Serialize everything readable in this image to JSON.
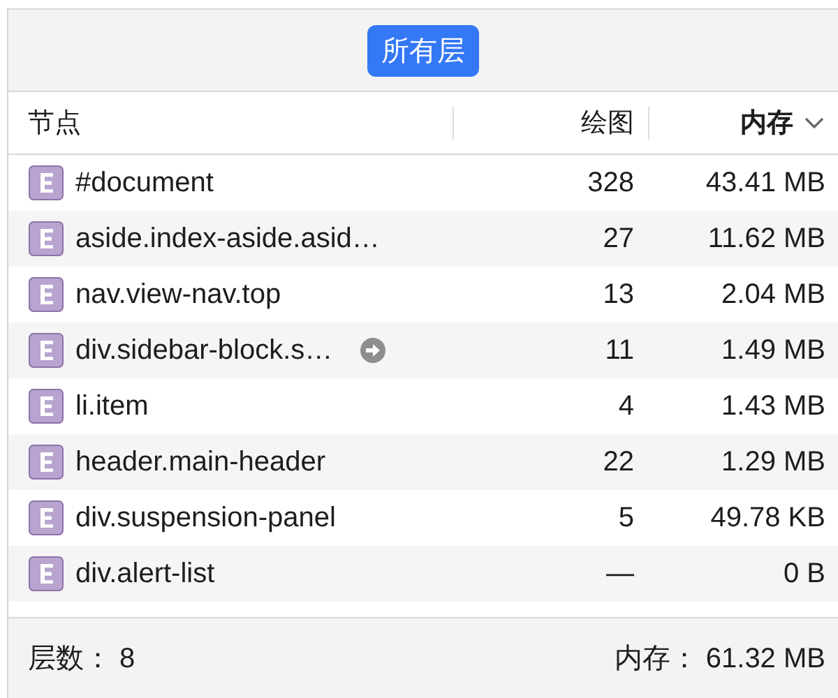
{
  "layer_filter": {
    "label": "所有层",
    "selected": true
  },
  "table": {
    "columns": [
      {
        "label": "节点",
        "sorted": false
      },
      {
        "label": "绘图",
        "sorted": false
      },
      {
        "label": "内存",
        "sorted": true
      }
    ],
    "rows": [
      {
        "node": "#document",
        "paints": "328",
        "memory": "43.41 MB",
        "go_to": false
      },
      {
        "node": "aside.index-aside.asid…",
        "paints": "27",
        "memory": "11.62 MB",
        "go_to": false
      },
      {
        "node": "nav.view-nav.top",
        "paints": "13",
        "memory": "2.04 MB",
        "go_to": false
      },
      {
        "node": "div.sidebar-block.s…",
        "paints": "11",
        "memory": "1.49 MB",
        "go_to": true
      },
      {
        "node": "li.item",
        "paints": "4",
        "memory": "1.43 MB",
        "go_to": false
      },
      {
        "node": "header.main-header",
        "paints": "22",
        "memory": "1.29 MB",
        "go_to": false
      },
      {
        "node": "div.suspension-panel",
        "paints": "5",
        "memory": "49.78 KB",
        "go_to": false
      },
      {
        "node": "div.alert-list",
        "paints": "—",
        "memory": "0 B",
        "go_to": false
      }
    ]
  },
  "status_bar": {
    "layer_count": "层数： 8",
    "total_memory": "内存： 61.32 MB"
  }
}
